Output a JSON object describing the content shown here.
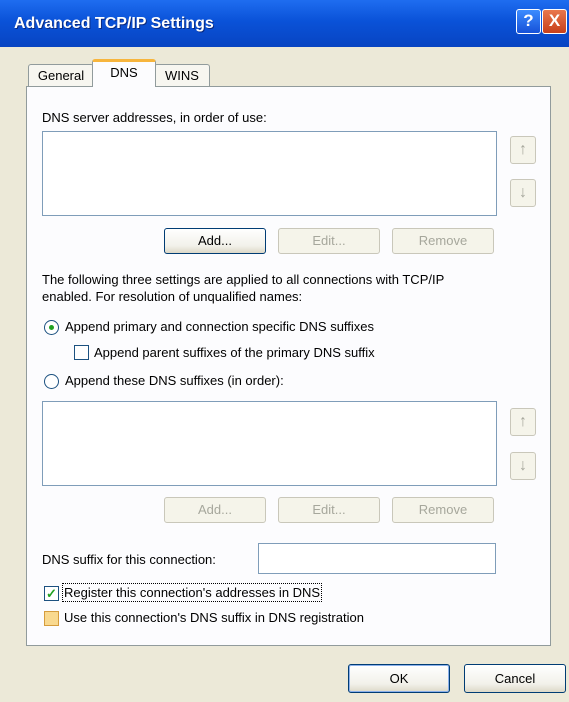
{
  "window": {
    "title": "Advanced TCP/IP Settings",
    "help_glyph": "?",
    "close_glyph": "X"
  },
  "tabs": [
    {
      "label": "General"
    },
    {
      "label": "DNS"
    },
    {
      "label": "WINS"
    }
  ],
  "dns": {
    "servers_label": "DNS server addresses, in order of use:",
    "servers": [],
    "buttons": {
      "add": "Add...",
      "edit": "Edit...",
      "remove": "Remove"
    },
    "description_line1": "The following three settings are applied to all connections with TCP/IP",
    "description_line2": "enabled. For resolution of unqualified names:",
    "radio_primary": {
      "label": "Append primary and connection specific DNS suffixes",
      "checked": true
    },
    "check_parent": {
      "label": "Append parent suffixes of the primary DNS suffix",
      "checked": false
    },
    "radio_these": {
      "label": "Append these DNS suffixes (in order):",
      "checked": false
    },
    "suffixes": [],
    "suffix_buttons": {
      "add": "Add...",
      "edit": "Edit...",
      "remove": "Remove"
    },
    "connection_suffix_label": "DNS suffix for this connection:",
    "connection_suffix_value": "",
    "register_check": {
      "label": "Register this connection's addresses in DNS",
      "checked": true
    },
    "use_suffix_check": {
      "label": "Use this connection's DNS suffix in DNS registration",
      "checked": false
    },
    "up_arrow": "↑",
    "down_arrow": "↓"
  },
  "footer": {
    "ok": "OK",
    "cancel": "Cancel"
  }
}
